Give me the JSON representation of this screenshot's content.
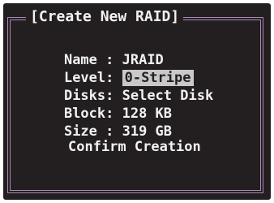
{
  "dialog": {
    "title": "[Create New RAID]",
    "fields": [
      {
        "label": "Name : ",
        "value": "JRAID"
      },
      {
        "label": "Level: ",
        "value": "0-Stripe"
      },
      {
        "label": "Disks: ",
        "value": "Select Disk"
      },
      {
        "label": "Block: ",
        "value": "128 KB"
      },
      {
        "label": "Size : ",
        "value": "319 GB"
      }
    ],
    "confirm_label": "Confirm Creation"
  },
  "colors": {
    "background": "#231f20",
    "border": "#a889b6",
    "text": "#f2f2f2",
    "selection": "#c9c9c9"
  }
}
